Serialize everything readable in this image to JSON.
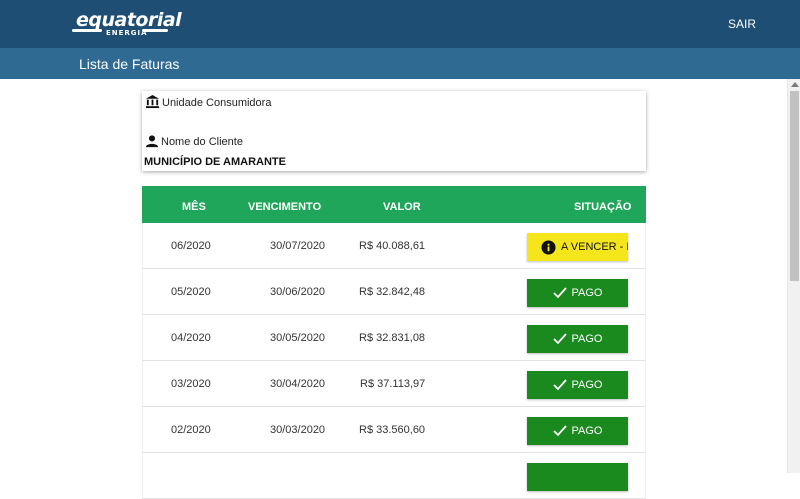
{
  "header": {
    "logo_text": "equatorial",
    "logo_sub": "ENERGIA",
    "logout_label": "SAIR"
  },
  "subheader": {
    "title": "Lista de Faturas"
  },
  "info": {
    "unit_label": "Unidade Consumidora",
    "client_label": "Nome do Cliente",
    "client_name": "MUNICÍPIO DE AMARANTE"
  },
  "table": {
    "headers": [
      "MÊS",
      "VENCIMENTO",
      "VALOR",
      "SITUAÇÃO"
    ],
    "rows": [
      {
        "month": "06/2020",
        "due": "30/07/2020",
        "value": "R$ 40.088,61",
        "status": "A VENCER - IN",
        "status_type": "due"
      },
      {
        "month": "05/2020",
        "due": "30/06/2020",
        "value": "R$ 32.842,48",
        "status": "PAGO",
        "status_type": "paid"
      },
      {
        "month": "04/2020",
        "due": "30/05/2020",
        "value": "R$ 32.831,08",
        "status": "PAGO",
        "status_type": "paid"
      },
      {
        "month": "03/2020",
        "due": "30/04/2020",
        "value": "R$ 37.113,97",
        "status": "PAGO",
        "status_type": "paid"
      },
      {
        "month": "02/2020",
        "due": "30/03/2020",
        "value": "R$ 33.560,60",
        "status": "PAGO",
        "status_type": "paid"
      },
      {
        "month": "",
        "due": "",
        "value": "",
        "status": "",
        "status_type": "paid"
      }
    ]
  },
  "colors": {
    "topbar": "#1e4e73",
    "subbar": "#2f6a93",
    "table_header": "#1fa65a",
    "paid": "#1a8a1f",
    "due": "#f5e61c"
  }
}
